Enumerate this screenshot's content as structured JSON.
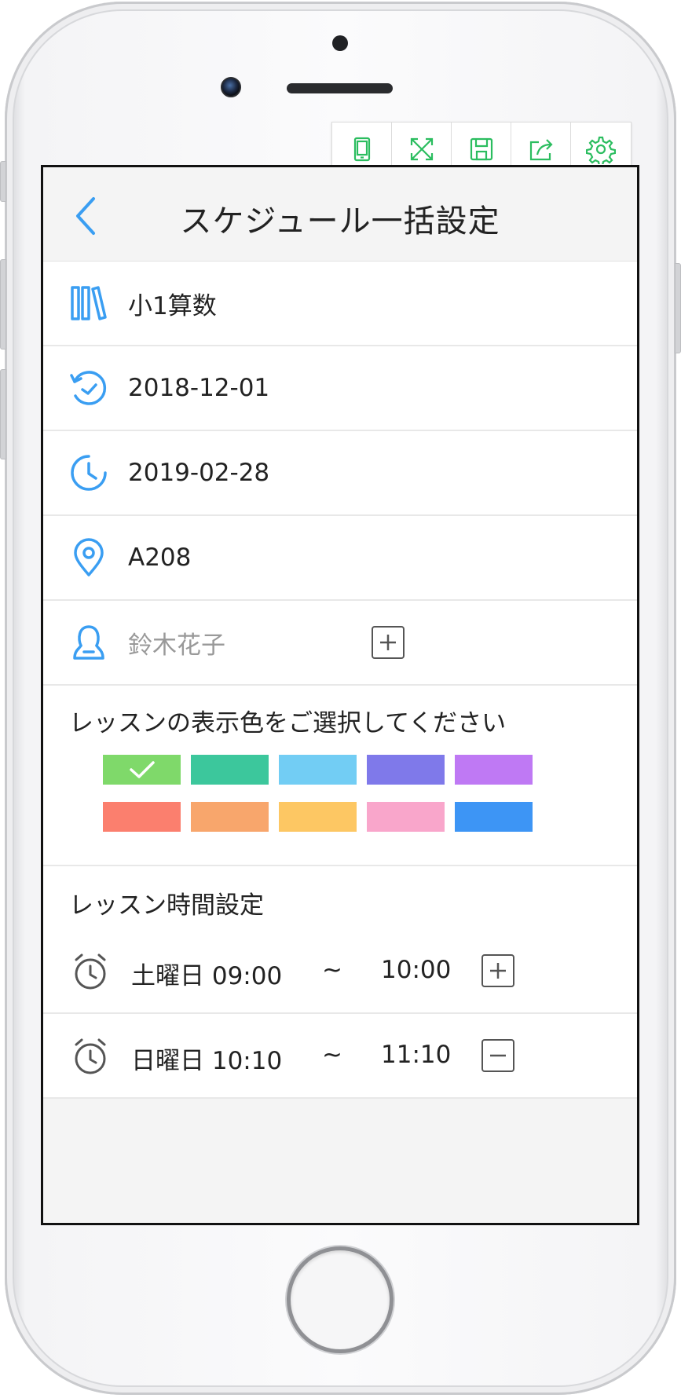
{
  "toolbar": {
    "items": [
      {
        "icon": "tablet-icon"
      },
      {
        "icon": "fullscreen-icon"
      },
      {
        "icon": "save-icon"
      },
      {
        "icon": "share-icon"
      },
      {
        "icon": "settings-gear-icon"
      }
    ]
  },
  "header": {
    "title": "スケジュール一括設定",
    "back_icon": "chevron-left-icon"
  },
  "form": {
    "course": {
      "value": "小1算数",
      "icon": "books-icon"
    },
    "start_date": {
      "value": "2018-12-01",
      "icon": "clock-start-icon"
    },
    "end_date": {
      "value": "2019-02-28",
      "icon": "clock-end-icon"
    },
    "room": {
      "value": "A208",
      "icon": "location-pin-icon"
    },
    "teacher": {
      "value": "鈴木花子",
      "icon": "person-icon",
      "add_icon": "plus-box-icon"
    }
  },
  "colors": {
    "title": "レッスンの表示色をご選択してください",
    "selected_index": 0,
    "swatches": [
      "#7fd96a",
      "#3cc79c",
      "#72cdf4",
      "#7f79ea",
      "#bf79f4",
      "#fb7f6e",
      "#f8a66c",
      "#fdc763",
      "#f9a6cb",
      "#3d95f5"
    ]
  },
  "lesson_time": {
    "title": "レッスン時間設定",
    "rows": [
      {
        "day_start": "土曜日 09:00",
        "separator": "~",
        "end": "10:00",
        "action_icon": "plus-box-icon"
      },
      {
        "day_start": "日曜日 10:10",
        "separator": "~",
        "end": "11:10",
        "action_icon": "minus-box-icon"
      }
    ]
  },
  "theme": {
    "accent": "#3a9ef2",
    "toolbar_green": "#2bbd5f"
  }
}
